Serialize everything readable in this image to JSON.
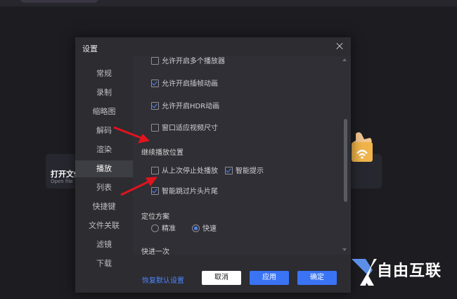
{
  "background": {
    "open_title": "打开文件",
    "open_subtitle": "Open file"
  },
  "dialog": {
    "title": "设置"
  },
  "sidebar": {
    "items": [
      {
        "label": "常规"
      },
      {
        "label": "录制"
      },
      {
        "label": "缩略图"
      },
      {
        "label": "解码"
      },
      {
        "label": "渲染"
      },
      {
        "label": "播放",
        "active": true
      },
      {
        "label": "列表"
      },
      {
        "label": "快捷键"
      },
      {
        "label": "文件关联"
      },
      {
        "label": "滤镜"
      },
      {
        "label": "下载"
      }
    ]
  },
  "content": {
    "options": [
      {
        "label": "允许开启多个播放器",
        "checked": false
      },
      {
        "label": "允许开启插帧动画",
        "checked": true
      },
      {
        "label": "允许开启HDR动画",
        "checked": true
      },
      {
        "label": "窗口适应视频尺寸",
        "checked": false
      }
    ],
    "resume_section": {
      "title": "继续播放位置",
      "resume_from_last": {
        "label": "从上次停止处播放",
        "checked": false
      },
      "smart_prompt": {
        "label": "智能提示",
        "checked": true
      },
      "skip_intro_outro": {
        "label": "智能跳过片头片尾",
        "checked": true
      }
    },
    "seek_section": {
      "title": "定位方案",
      "precise": {
        "label": "精准",
        "checked": false
      },
      "fast": {
        "label": "快速",
        "checked": true
      }
    },
    "fast_forward_title": "快进一次"
  },
  "footer": {
    "restore_label": "恢复默认设置",
    "cancel_label": "取消",
    "apply_label": "应用",
    "ok_label": "确定"
  },
  "watermark": {
    "text": "自由互联"
  },
  "colors": {
    "accent": "#3a74f4",
    "link": "#4f86ff",
    "arrow": "#e0141e"
  }
}
